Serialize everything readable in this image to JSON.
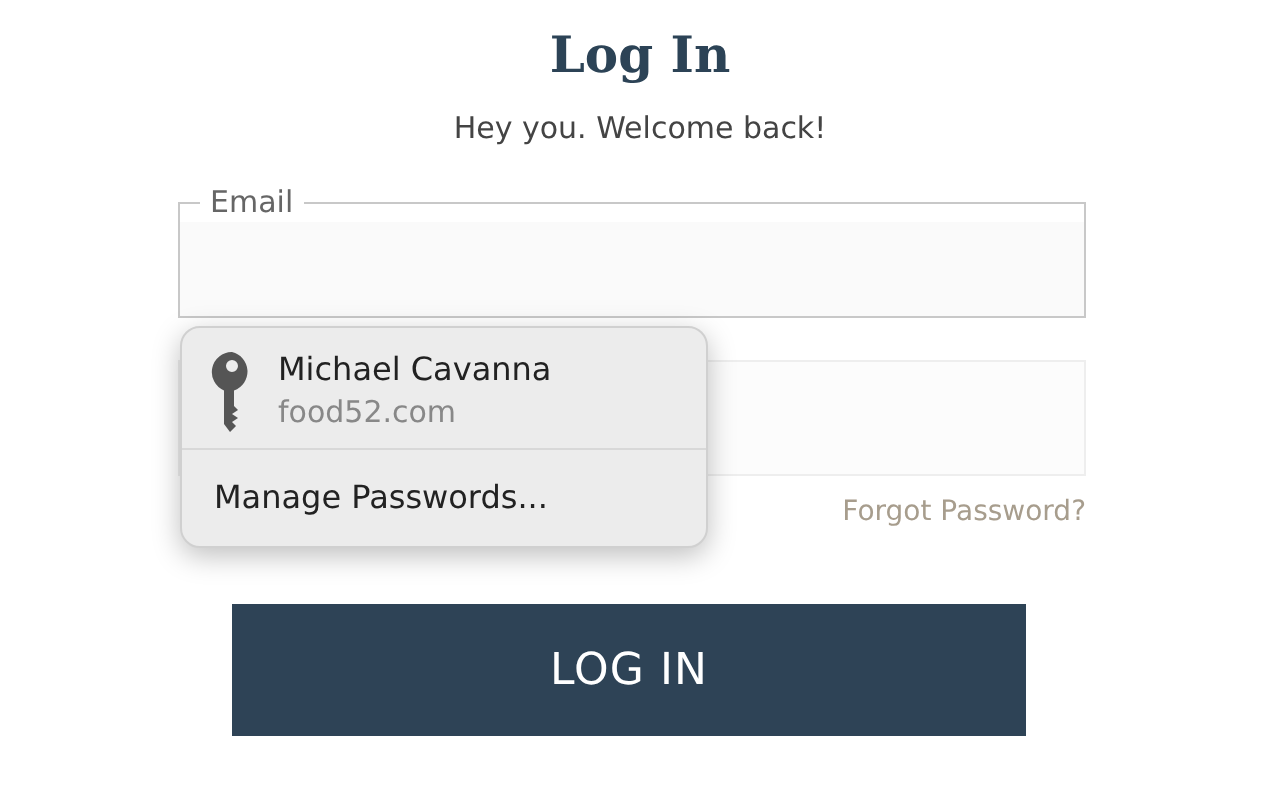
{
  "title": "Log In",
  "subtitle": "Hey you. Welcome back!",
  "email_field": {
    "label": "Email"
  },
  "forgot_link": "Forgot Password?",
  "login_button": "LOG IN",
  "autofill_popup": {
    "account": {
      "name": "Michael Cavanna",
      "site": "food52.com"
    },
    "manage": "Manage Passwords..."
  }
}
